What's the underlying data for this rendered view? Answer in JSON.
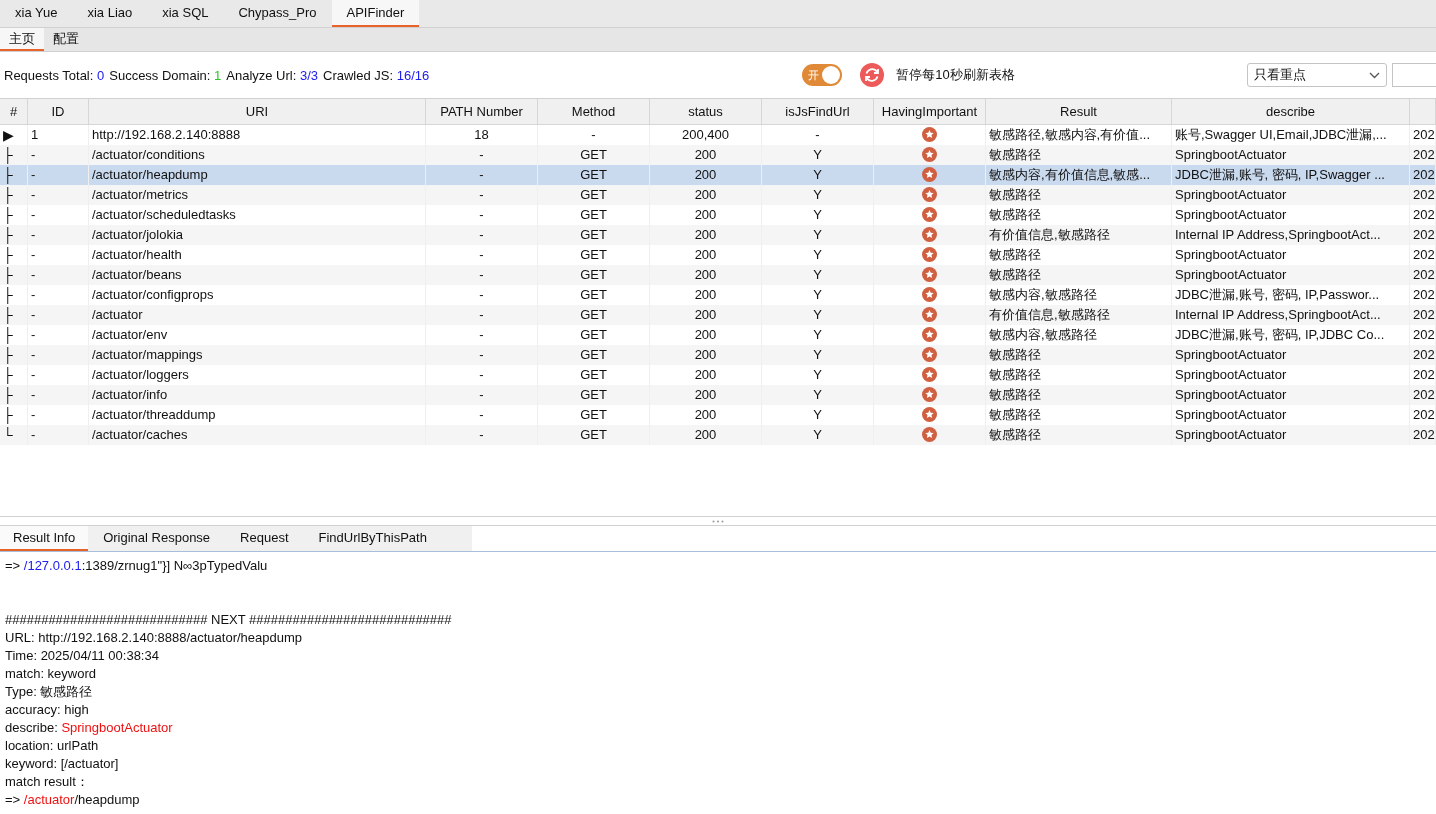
{
  "top_tabs": [
    {
      "label": "xia Yue",
      "selected": false
    },
    {
      "label": "xia Liao",
      "selected": false
    },
    {
      "label": "xia SQL",
      "selected": false
    },
    {
      "label": "Chypass_Pro",
      "selected": false
    },
    {
      "label": "APIFinder",
      "selected": true
    }
  ],
  "sub_tabs": [
    {
      "label": "主页",
      "selected": true
    },
    {
      "label": "配置",
      "selected": false
    }
  ],
  "stats": [
    {
      "label": "Requests Total:",
      "value": "0",
      "kind": "blue"
    },
    {
      "label": "Success Domain:",
      "value": "1",
      "kind": "green"
    },
    {
      "label": "Analyze Url:",
      "value": "3/3",
      "kind": "blue"
    },
    {
      "label": "Crawled JS:",
      "value": "16/16",
      "kind": "blue"
    }
  ],
  "toggle": {
    "label": "开",
    "on": true
  },
  "refresh_label": "暂停每10秒刷新表格",
  "filter": {
    "value": "只看重点"
  },
  "table": {
    "columns": [
      "#",
      "ID",
      "URI",
      "PATH Number",
      "Method",
      "status",
      "isJsFindUrl",
      "HavingImportant",
      "Result",
      "describe"
    ],
    "rows": [
      {
        "tree": "▶",
        "id": "1",
        "uri": "http://192.168.2.140:8888",
        "path_number": "18",
        "method": "-",
        "status": "200,400",
        "is_js_find_url": "-",
        "important": true,
        "result": "敏感路径,敏感内容,有价值...",
        "describe": "账号,Swagger UI,Email,JDBC泄漏,...",
        "column_11": "202",
        "selected": false
      },
      {
        "tree": "├",
        "id": "-",
        "uri": "/actuator/conditions",
        "path_number": "-",
        "method": "GET",
        "status": "200",
        "is_js_find_url": "Y",
        "important": true,
        "result": "敏感路径",
        "describe": "SpringbootActuator",
        "column_11": "202",
        "selected": false
      },
      {
        "tree": "├",
        "id": "-",
        "uri": "/actuator/heapdump",
        "path_number": "-",
        "method": "GET",
        "status": "200",
        "is_js_find_url": "Y",
        "important": true,
        "result": "敏感内容,有价值信息,敏感...",
        "describe": "JDBC泄漏,账号, 密码, IP,Swagger ...",
        "column_11": "202",
        "selected": true
      },
      {
        "tree": "├",
        "id": "-",
        "uri": "/actuator/metrics",
        "path_number": "-",
        "method": "GET",
        "status": "200",
        "is_js_find_url": "Y",
        "important": true,
        "result": "敏感路径",
        "describe": "SpringbootActuator",
        "column_11": "202",
        "selected": false
      },
      {
        "tree": "├",
        "id": "-",
        "uri": "/actuator/scheduledtasks",
        "path_number": "-",
        "method": "GET",
        "status": "200",
        "is_js_find_url": "Y",
        "important": true,
        "result": "敏感路径",
        "describe": "SpringbootActuator",
        "column_11": "202",
        "selected": false
      },
      {
        "tree": "├",
        "id": "-",
        "uri": "/actuator/jolokia",
        "path_number": "-",
        "method": "GET",
        "status": "200",
        "is_js_find_url": "Y",
        "important": true,
        "result": "有价值信息,敏感路径",
        "describe": "Internal IP Address,SpringbootAct...",
        "column_11": "202",
        "selected": false
      },
      {
        "tree": "├",
        "id": "-",
        "uri": "/actuator/health",
        "path_number": "-",
        "method": "GET",
        "status": "200",
        "is_js_find_url": "Y",
        "important": true,
        "result": "敏感路径",
        "describe": "SpringbootActuator",
        "column_11": "202",
        "selected": false
      },
      {
        "tree": "├",
        "id": "-",
        "uri": "/actuator/beans",
        "path_number": "-",
        "method": "GET",
        "status": "200",
        "is_js_find_url": "Y",
        "important": true,
        "result": "敏感路径",
        "describe": "SpringbootActuator",
        "column_11": "202",
        "selected": false
      },
      {
        "tree": "├",
        "id": "-",
        "uri": "/actuator/configprops",
        "path_number": "-",
        "method": "GET",
        "status": "200",
        "is_js_find_url": "Y",
        "important": true,
        "result": "敏感内容,敏感路径",
        "describe": "JDBC泄漏,账号, 密码, IP,Passwor...",
        "column_11": "202",
        "selected": false
      },
      {
        "tree": "├",
        "id": "-",
        "uri": "/actuator",
        "path_number": "-",
        "method": "GET",
        "status": "200",
        "is_js_find_url": "Y",
        "important": true,
        "result": "有价值信息,敏感路径",
        "describe": "Internal IP Address,SpringbootAct...",
        "column_11": "202",
        "selected": false
      },
      {
        "tree": "├",
        "id": "-",
        "uri": "/actuator/env",
        "path_number": "-",
        "method": "GET",
        "status": "200",
        "is_js_find_url": "Y",
        "important": true,
        "result": "敏感内容,敏感路径",
        "describe": "JDBC泄漏,账号, 密码, IP,JDBC Co...",
        "column_11": "202",
        "selected": false
      },
      {
        "tree": "├",
        "id": "-",
        "uri": "/actuator/mappings",
        "path_number": "-",
        "method": "GET",
        "status": "200",
        "is_js_find_url": "Y",
        "important": true,
        "result": "敏感路径",
        "describe": "SpringbootActuator",
        "column_11": "202",
        "selected": false
      },
      {
        "tree": "├",
        "id": "-",
        "uri": "/actuator/loggers",
        "path_number": "-",
        "method": "GET",
        "status": "200",
        "is_js_find_url": "Y",
        "important": true,
        "result": "敏感路径",
        "describe": "SpringbootActuator",
        "column_11": "202",
        "selected": false
      },
      {
        "tree": "├",
        "id": "-",
        "uri": "/actuator/info",
        "path_number": "-",
        "method": "GET",
        "status": "200",
        "is_js_find_url": "Y",
        "important": true,
        "result": "敏感路径",
        "describe": "SpringbootActuator",
        "column_11": "202",
        "selected": false
      },
      {
        "tree": "├",
        "id": "-",
        "uri": "/actuator/threaddump",
        "path_number": "-",
        "method": "GET",
        "status": "200",
        "is_js_find_url": "Y",
        "important": true,
        "result": "敏感路径",
        "describe": "SpringbootActuator",
        "column_11": "202",
        "selected": false
      },
      {
        "tree": "└",
        "id": "-",
        "uri": "/actuator/caches",
        "path_number": "-",
        "method": "GET",
        "status": "200",
        "is_js_find_url": "Y",
        "important": true,
        "result": "敏感路径",
        "describe": "SpringbootActuator",
        "column_11": "202",
        "selected": false
      }
    ]
  },
  "detail_tabs": [
    {
      "label": "Result Info",
      "selected": true
    },
    {
      "label": "Original Response",
      "selected": false
    },
    {
      "label": "Request",
      "selected": false
    },
    {
      "label": "FindUrlByThisPath",
      "selected": false
    }
  ],
  "result_lines": [
    [
      {
        "text": "=> ",
        "kind": "plain"
      },
      {
        "text": "/127.0.0.1",
        "kind": "link"
      },
      {
        "text": ":1389/zrnug1\"}] N∞3pTypedValu",
        "kind": "plain"
      }
    ],
    [
      {
        "text": "############################ NEXT ############################",
        "kind": "separator"
      }
    ],
    [
      {
        "text": "URL: http://192.168.2.140:8888/actuator/heapdump",
        "kind": "plain"
      }
    ],
    [
      {
        "text": "Time: 2025/04/11 00:38:34",
        "kind": "plain"
      }
    ],
    [
      {
        "text": "match: keyword",
        "kind": "plain"
      }
    ],
    [
      {
        "text": "Type: 敏感路径",
        "kind": "plain"
      }
    ],
    [
      {
        "text": "accuracy: high",
        "kind": "plain"
      }
    ],
    [
      {
        "text": "describe: ",
        "kind": "plain"
      },
      {
        "text": "SpringbootActuator",
        "kind": "highlight"
      }
    ],
    [
      {
        "text": "location: urlPath",
        "kind": "plain"
      }
    ],
    [
      {
        "text": "keyword: [/actuator]",
        "kind": "plain"
      }
    ],
    [
      {
        "text": "match result：",
        "kind": "plain"
      }
    ],
    [
      {
        "text": "=> ",
        "kind": "plain"
      },
      {
        "text": "/actuator",
        "kind": "highlight"
      },
      {
        "text": "/heapdump",
        "kind": "plain"
      }
    ]
  ]
}
